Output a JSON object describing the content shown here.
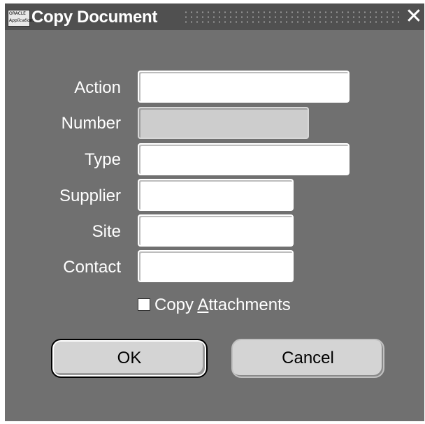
{
  "window": {
    "logo_line1": "ORACLE",
    "logo_line2": "Applications",
    "title": "Copy Document",
    "close_glyph": "✕"
  },
  "form": {
    "action_label": "Action",
    "action_value": "",
    "number_label": "Number",
    "number_value": "",
    "type_label": "Type",
    "type_value": "",
    "supplier_label": "Supplier",
    "supplier_value": "",
    "site_label": "Site",
    "site_value": "",
    "contact_label": "Contact",
    "contact_value": ""
  },
  "options": {
    "copy_attachments_prefix": "Copy ",
    "copy_attachments_mnemonic": "A",
    "copy_attachments_rest": "ttachments",
    "copy_attachments_checked": false
  },
  "buttons": {
    "ok_label": "OK",
    "cancel_label": "Cancel"
  },
  "colors": {
    "window_bg": "#707070",
    "titlebar_bg": "#505050",
    "field_bg": "#ffffff",
    "disabled_field_bg": "#cdcdcd",
    "button_bg": "#d4d4d4"
  }
}
